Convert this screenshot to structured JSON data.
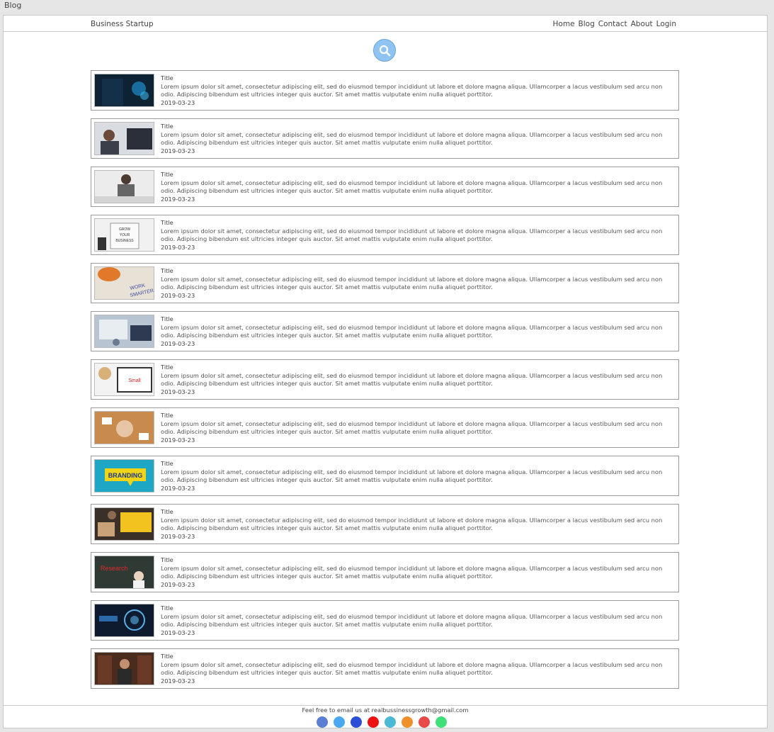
{
  "window": {
    "title": "Blog"
  },
  "header": {
    "brand": "Business Startup",
    "nav": [
      "Home",
      "Blog",
      "Contact",
      "About",
      "Login"
    ]
  },
  "search": {
    "icon": "search-icon"
  },
  "posts": [
    {
      "title": "Title",
      "body": "Lorem ipsum dolor sit amet, consectetur adipiscing elit, sed do eiusmod tempor incididunt ut labore et dolore magna aliqua. Ullamcorper a lacus vestibulum sed arcu non odio. Adipiscing bibendum est ultricies integer quis auctor. Sit amet mattis vulputate enim nulla aliquet porttitor.",
      "date": "2019-03-23",
      "image": "tech-hand-photo"
    },
    {
      "title": "Title",
      "body": "Lorem ipsum dolor sit amet, consectetur adipiscing elit, sed do eiusmod tempor incididunt ut labore et dolore magna aliqua. Ullamcorper a lacus vestibulum sed arcu non odio. Adipiscing bibendum est ultricies integer quis auctor. Sit amet mattis vulputate enim nulla aliquet porttitor.",
      "date": "2019-03-23",
      "image": "office-meeting-photo"
    },
    {
      "title": "Title",
      "body": "Lorem ipsum dolor sit amet, consectetur adipiscing elit, sed do eiusmod tempor incididunt ut labore et dolore magna aliqua. Ullamcorper a lacus vestibulum sed arcu non odio. Adipiscing bibendum est ultricies integer quis auctor. Sit amet mattis vulputate enim nulla aliquet porttitor.",
      "date": "2019-03-23",
      "image": "stressed-man-photo"
    },
    {
      "title": "Title",
      "body": "Lorem ipsum dolor sit amet, consectetur adipiscing elit, sed do eiusmod tempor incididunt ut labore et dolore magna aliqua. Ullamcorper a lacus vestibulum sed arcu non odio. Adipiscing bibendum est ultricies integer quis auctor. Sit amet mattis vulputate enim nulla aliquet porttitor.",
      "date": "2019-03-23",
      "image": "grow-your-business-photo"
    },
    {
      "title": "Title",
      "body": "Lorem ipsum dolor sit amet, consectetur adipiscing elit, sed do eiusmod tempor incididunt ut labore et dolore magna aliqua. Ullamcorper a lacus vestibulum sed arcu non odio. Adipiscing bibendum est ultricies integer quis auctor. Sit amet mattis vulputate enim nulla aliquet porttitor.",
      "date": "2019-03-23",
      "image": "work-smarter-photo"
    },
    {
      "title": "Title",
      "body": "Lorem ipsum dolor sit amet, consectetur adipiscing elit, sed do eiusmod tempor incididunt ut labore et dolore magna aliqua. Ullamcorper a lacus vestibulum sed arcu non odio. Adipiscing bibendum est ultricies integer quis auctor. Sit amet mattis vulputate enim nulla aliquet porttitor.",
      "date": "2019-03-23",
      "image": "tablet-office-photo"
    },
    {
      "title": "Title",
      "body": "Lorem ipsum dolor sit amet, consectetur adipiscing elit, sed do eiusmod tempor incididunt ut labore et dolore magna aliqua. Ullamcorper a lacus vestibulum sed arcu non odio. Adipiscing bibendum est ultricies integer quis auctor. Sit amet mattis vulputate enim nulla aliquet porttitor.",
      "date": "2019-03-23",
      "image": "tablet-coffee-photo"
    },
    {
      "title": "Title",
      "body": "Lorem ipsum dolor sit amet, consectetur adipiscing elit, sed do eiusmod tempor incididunt ut labore et dolore magna aliqua. Ullamcorper a lacus vestibulum sed arcu non odio. Adipiscing bibendum est ultricies integer quis auctor. Sit amet mattis vulputate enim nulla aliquet porttitor.",
      "date": "2019-03-23",
      "image": "team-hands-photo"
    },
    {
      "title": "Title",
      "body": "Lorem ipsum dolor sit amet, consectetur adipiscing elit, sed do eiusmod tempor incididunt ut labore et dolore magna aliqua. Ullamcorper a lacus vestibulum sed arcu non odio. Adipiscing bibendum est ultricies integer quis auctor. Sit amet mattis vulputate enim nulla aliquet porttitor.",
      "date": "2019-03-23",
      "image": "branding-photo",
      "caption": "BRANDING"
    },
    {
      "title": "Title",
      "body": "Lorem ipsum dolor sit amet, consectetur adipiscing elit, sed do eiusmod tempor incididunt ut labore et dolore magna aliqua. Ullamcorper a lacus vestibulum sed arcu non odio. Adipiscing bibendum est ultricies integer quis auctor. Sit amet mattis vulputate enim nulla aliquet porttitor.",
      "date": "2019-03-23",
      "image": "laptop-desk-photo"
    },
    {
      "title": "Title",
      "body": "Lorem ipsum dolor sit amet, consectetur adipiscing elit, sed do eiusmod tempor incididunt ut labore et dolore magna aliqua. Ullamcorper a lacus vestibulum sed arcu non odio. Adipiscing bibendum est ultricies integer quis auctor. Sit amet mattis vulputate enim nulla aliquet porttitor.",
      "date": "2019-03-23",
      "image": "research-chalkboard-photo"
    },
    {
      "title": "Title",
      "body": "Lorem ipsum dolor sit amet, consectetur adipiscing elit, sed do eiusmod tempor incididunt ut labore et dolore magna aliqua. Ullamcorper a lacus vestibulum sed arcu non odio. Adipiscing bibendum est ultricies integer quis auctor. Sit amet mattis vulputate enim nulla aliquet porttitor.",
      "date": "2019-03-23",
      "image": "digital-interface-photo"
    },
    {
      "title": "Title",
      "body": "Lorem ipsum dolor sit amet, consectetur adipiscing elit, sed do eiusmod tempor incididunt ut labore et dolore magna aliqua. Ullamcorper a lacus vestibulum sed arcu non odio. Adipiscing bibendum est ultricies integer quis auctor. Sit amet mattis vulputate enim nulla aliquet porttitor.",
      "date": "2019-03-23",
      "image": "library-man-photo"
    }
  ],
  "footer": {
    "text": "Feel free to email us at realbussinessgrowth@gmail.com",
    "socials": [
      {
        "name": "social-icon-1",
        "color": "#5b7fd4"
      },
      {
        "name": "social-icon-2",
        "color": "#4aa8f0"
      },
      {
        "name": "social-icon-3",
        "color": "#2a4fd6"
      },
      {
        "name": "social-icon-4",
        "color": "#ee1111"
      },
      {
        "name": "social-icon-5",
        "color": "#4bb8d4"
      },
      {
        "name": "social-icon-6",
        "color": "#f0902a"
      },
      {
        "name": "social-icon-7",
        "color": "#e84a4a"
      },
      {
        "name": "social-icon-8",
        "color": "#3fe07a"
      }
    ]
  }
}
